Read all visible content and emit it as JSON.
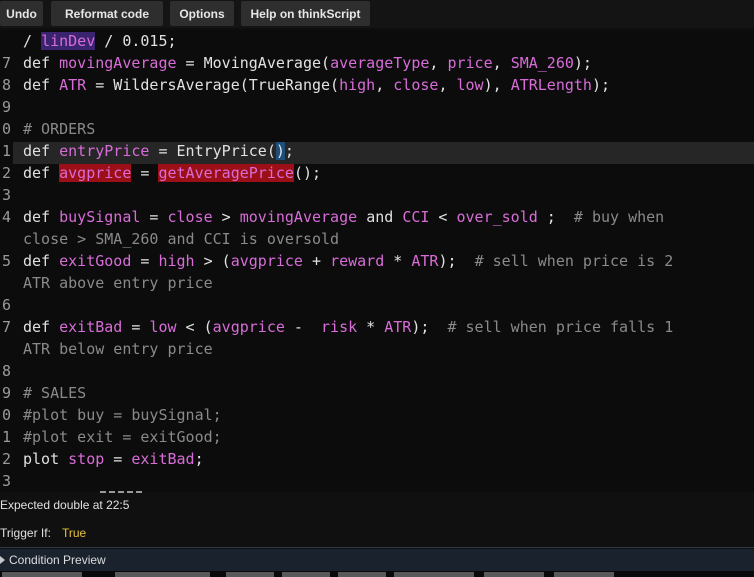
{
  "toolbar": {
    "undo": "Undo",
    "reformat": "Reformat code",
    "options": "Options",
    "help": "Help on thinkScript"
  },
  "gutter": [
    "",
    "7",
    "8",
    "9",
    "0",
    "1",
    "2",
    "3",
    "4",
    "",
    "5",
    "",
    "6",
    "7",
    "",
    "8",
    "9",
    "0",
    "1",
    "2",
    "3"
  ],
  "code": {
    "l0_a": "/ ",
    "l0_b": "linDev",
    "l0_c": " / 0.015;",
    "l1_def": "def",
    "l1_id": "movingAverage",
    "l1_mid": " = MovingAverage(",
    "l1_a": "averageType",
    "l1_b": "price",
    "l1_c": "SMA_260",
    "l1_end": ");",
    "l2_def": "def",
    "l2_id": "ATR",
    "l2_mid": " = WildersAverage(TrueRange(",
    "l2_a": "high",
    "l2_b": "close",
    "l2_c": "low",
    "l2_m2": "), ",
    "l2_d": "ATRLength",
    "l2_end": ");",
    "l4_comment": "# ORDERS",
    "l5_def": "def",
    "l5_id": "entryPrice",
    "l5_mid": " = EntryPrice(",
    "l5_paren": ")",
    "l5_end": ";",
    "l6_def": "def",
    "l6_id": "avgprice",
    "l6_mid": " = ",
    "l6_fn": "getAveragePrice",
    "l6_end": "();",
    "l8_def": "def",
    "l8_id": "buySignal",
    "l8_a": "close",
    "l8_b": "movingAverage",
    "l8_and": "and",
    "l8_cci": "CCI",
    "l8_c": "over_sold",
    "l8_comment": "# buy when",
    "l9_comment": "close > SMA_260 and CCI is oversold",
    "l10_def": "def",
    "l10_id": "exitGood",
    "l10_a": "high",
    "l10_b": "avgprice",
    "l10_c": "reward",
    "l10_d": "ATR",
    "l10_comment": "# sell when price is 2",
    "l11_comment": "ATR above entry price",
    "l13_def": "def",
    "l13_id": "exitBad",
    "l13_a": "low",
    "l13_b": "avgprice",
    "l13_c": "risk",
    "l13_d": "ATR",
    "l13_comment": "# sell when price falls 1",
    "l14_comment": "ATR below entry price",
    "l16_comment": "# SALES",
    "l17_comment": "#plot buy = buySignal;",
    "l18_comment": "#plot exit = exitGood;",
    "l19_kw": "plot",
    "l19_id": "stop",
    "l19_a": "exitBad",
    "l19_end": ";"
  },
  "status": {
    "message": "Expected double at 22:5",
    "trigger_label": "Trigger If:",
    "trigger_value": "True"
  },
  "condition_preview": {
    "title": "Condition Preview"
  },
  "colors": {
    "identifier": "#d86cd8",
    "comment": "#8a8a8a",
    "error": "#9c0f16",
    "trigger_value": "#e8c23a"
  }
}
